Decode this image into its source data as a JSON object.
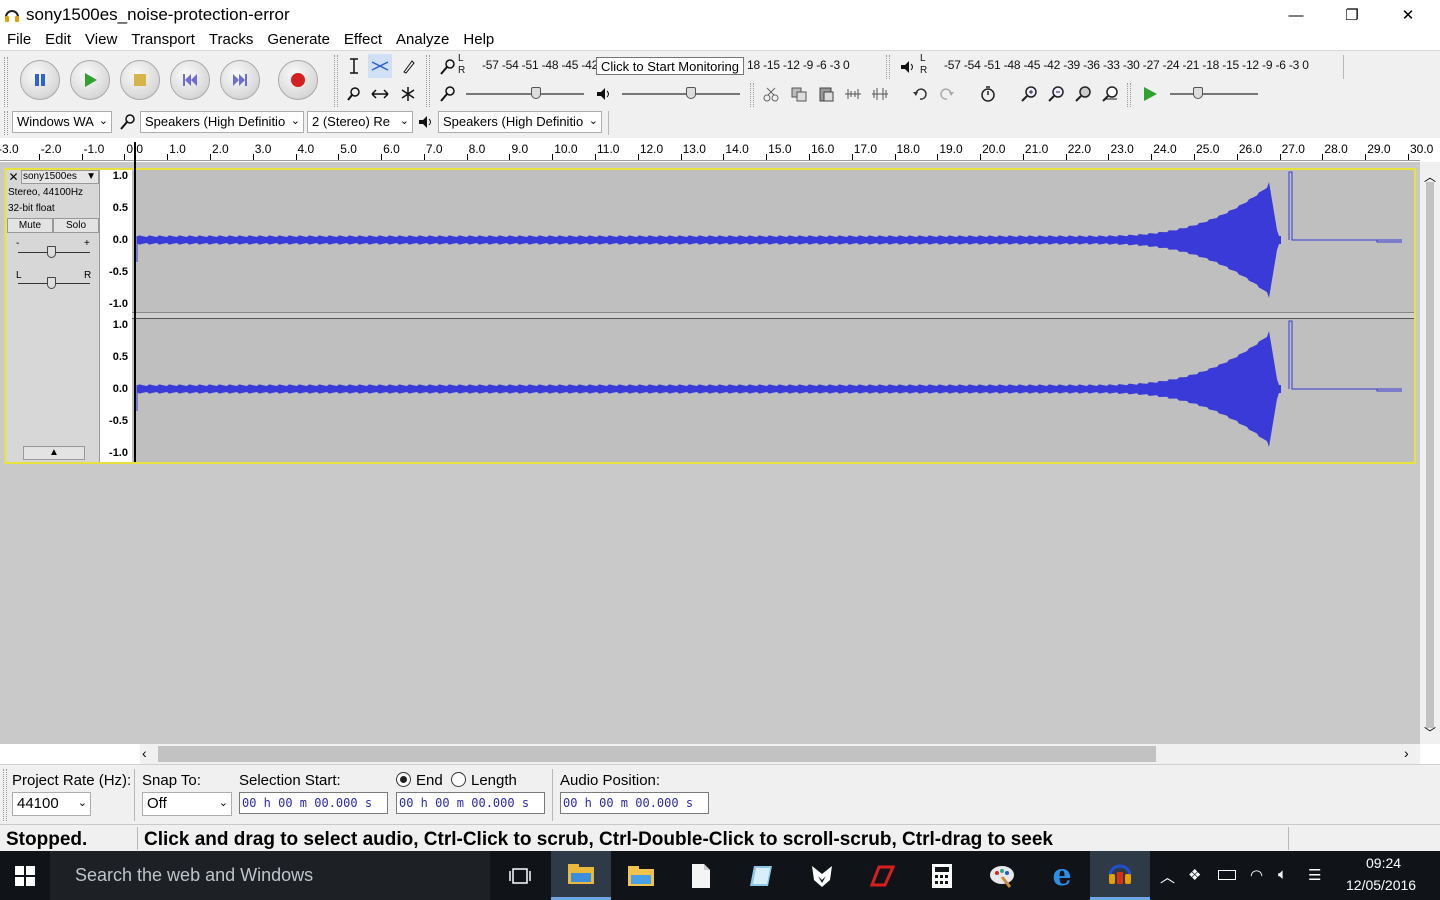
{
  "window": {
    "title": "sony1500es_noise-protection-error",
    "minimize": "—",
    "maximize": "❐",
    "close": "✕"
  },
  "menu": [
    "File",
    "Edit",
    "View",
    "Transport",
    "Tracks",
    "Generate",
    "Effect",
    "Analyze",
    "Help"
  ],
  "meters": {
    "record_scale": "-57 -54 -51 -48 -45 -42",
    "record_tooltip": "Click to Start Monitoring",
    "record_scale_tail": "18 -15 -12  -9  -6  -3  0",
    "play_scale": "-57 -54 -51 -48 -45 -42 -39 -36 -33 -30 -27 -24 -21 -18 -15 -12  -9  -6  -3  0",
    "lr_L": "L",
    "lr_R": "R"
  },
  "device": {
    "host": "Windows WA",
    "recording_device": "Speakers (High Definitio",
    "channels": "2 (Stereo) Re",
    "playback_device": "Speakers (High Definitio"
  },
  "ruler": {
    "labels": [
      "-3.0",
      "-2.0",
      "-1.0",
      "0.0",
      "1.0",
      "2.0",
      "3.0",
      "4.0",
      "5.0",
      "6.0",
      "7.0",
      "8.0",
      "9.0",
      "10.0",
      "11.0",
      "12.0",
      "13.0",
      "14.0",
      "15.0",
      "16.0",
      "17.0",
      "18.0",
      "19.0",
      "20.0",
      "21.0",
      "22.0",
      "23.0",
      "24.0",
      "25.0",
      "26.0",
      "27.0",
      "28.0",
      "29.0",
      "30.0"
    ],
    "start": -3.0,
    "end": 30.0
  },
  "track": {
    "name": "sony1500es",
    "format_rate": "Stereo, 44100Hz",
    "format_bits": "32-bit float",
    "mute": "Mute",
    "solo": "Solo",
    "gain_minus": "-",
    "gain_plus": "+",
    "pan_L": "L",
    "pan_R": "R",
    "scale": [
      "1.0",
      "0.5",
      "0.0",
      "-0.5",
      "-1.0"
    ],
    "wave_color": "#3a3ad8"
  },
  "selection": {
    "project_rate_label": "Project Rate (Hz):",
    "project_rate": "44100",
    "snap_label": "Snap To:",
    "snap_value": "Off",
    "sel_start_label": "Selection Start:",
    "end_label": "End",
    "length_label": "Length",
    "audio_pos_label": "Audio Position:",
    "time_value": "00 h 00 m 00.000 s"
  },
  "status": {
    "state": "Stopped.",
    "hint": "Click and drag to select audio, Ctrl-Click to scrub, Ctrl-Double-Click to scroll-scrub, Ctrl-drag to seek"
  },
  "taskbar": {
    "search_placeholder": "Search the web and Windows",
    "time": "09:24",
    "date": "12/05/2016"
  }
}
